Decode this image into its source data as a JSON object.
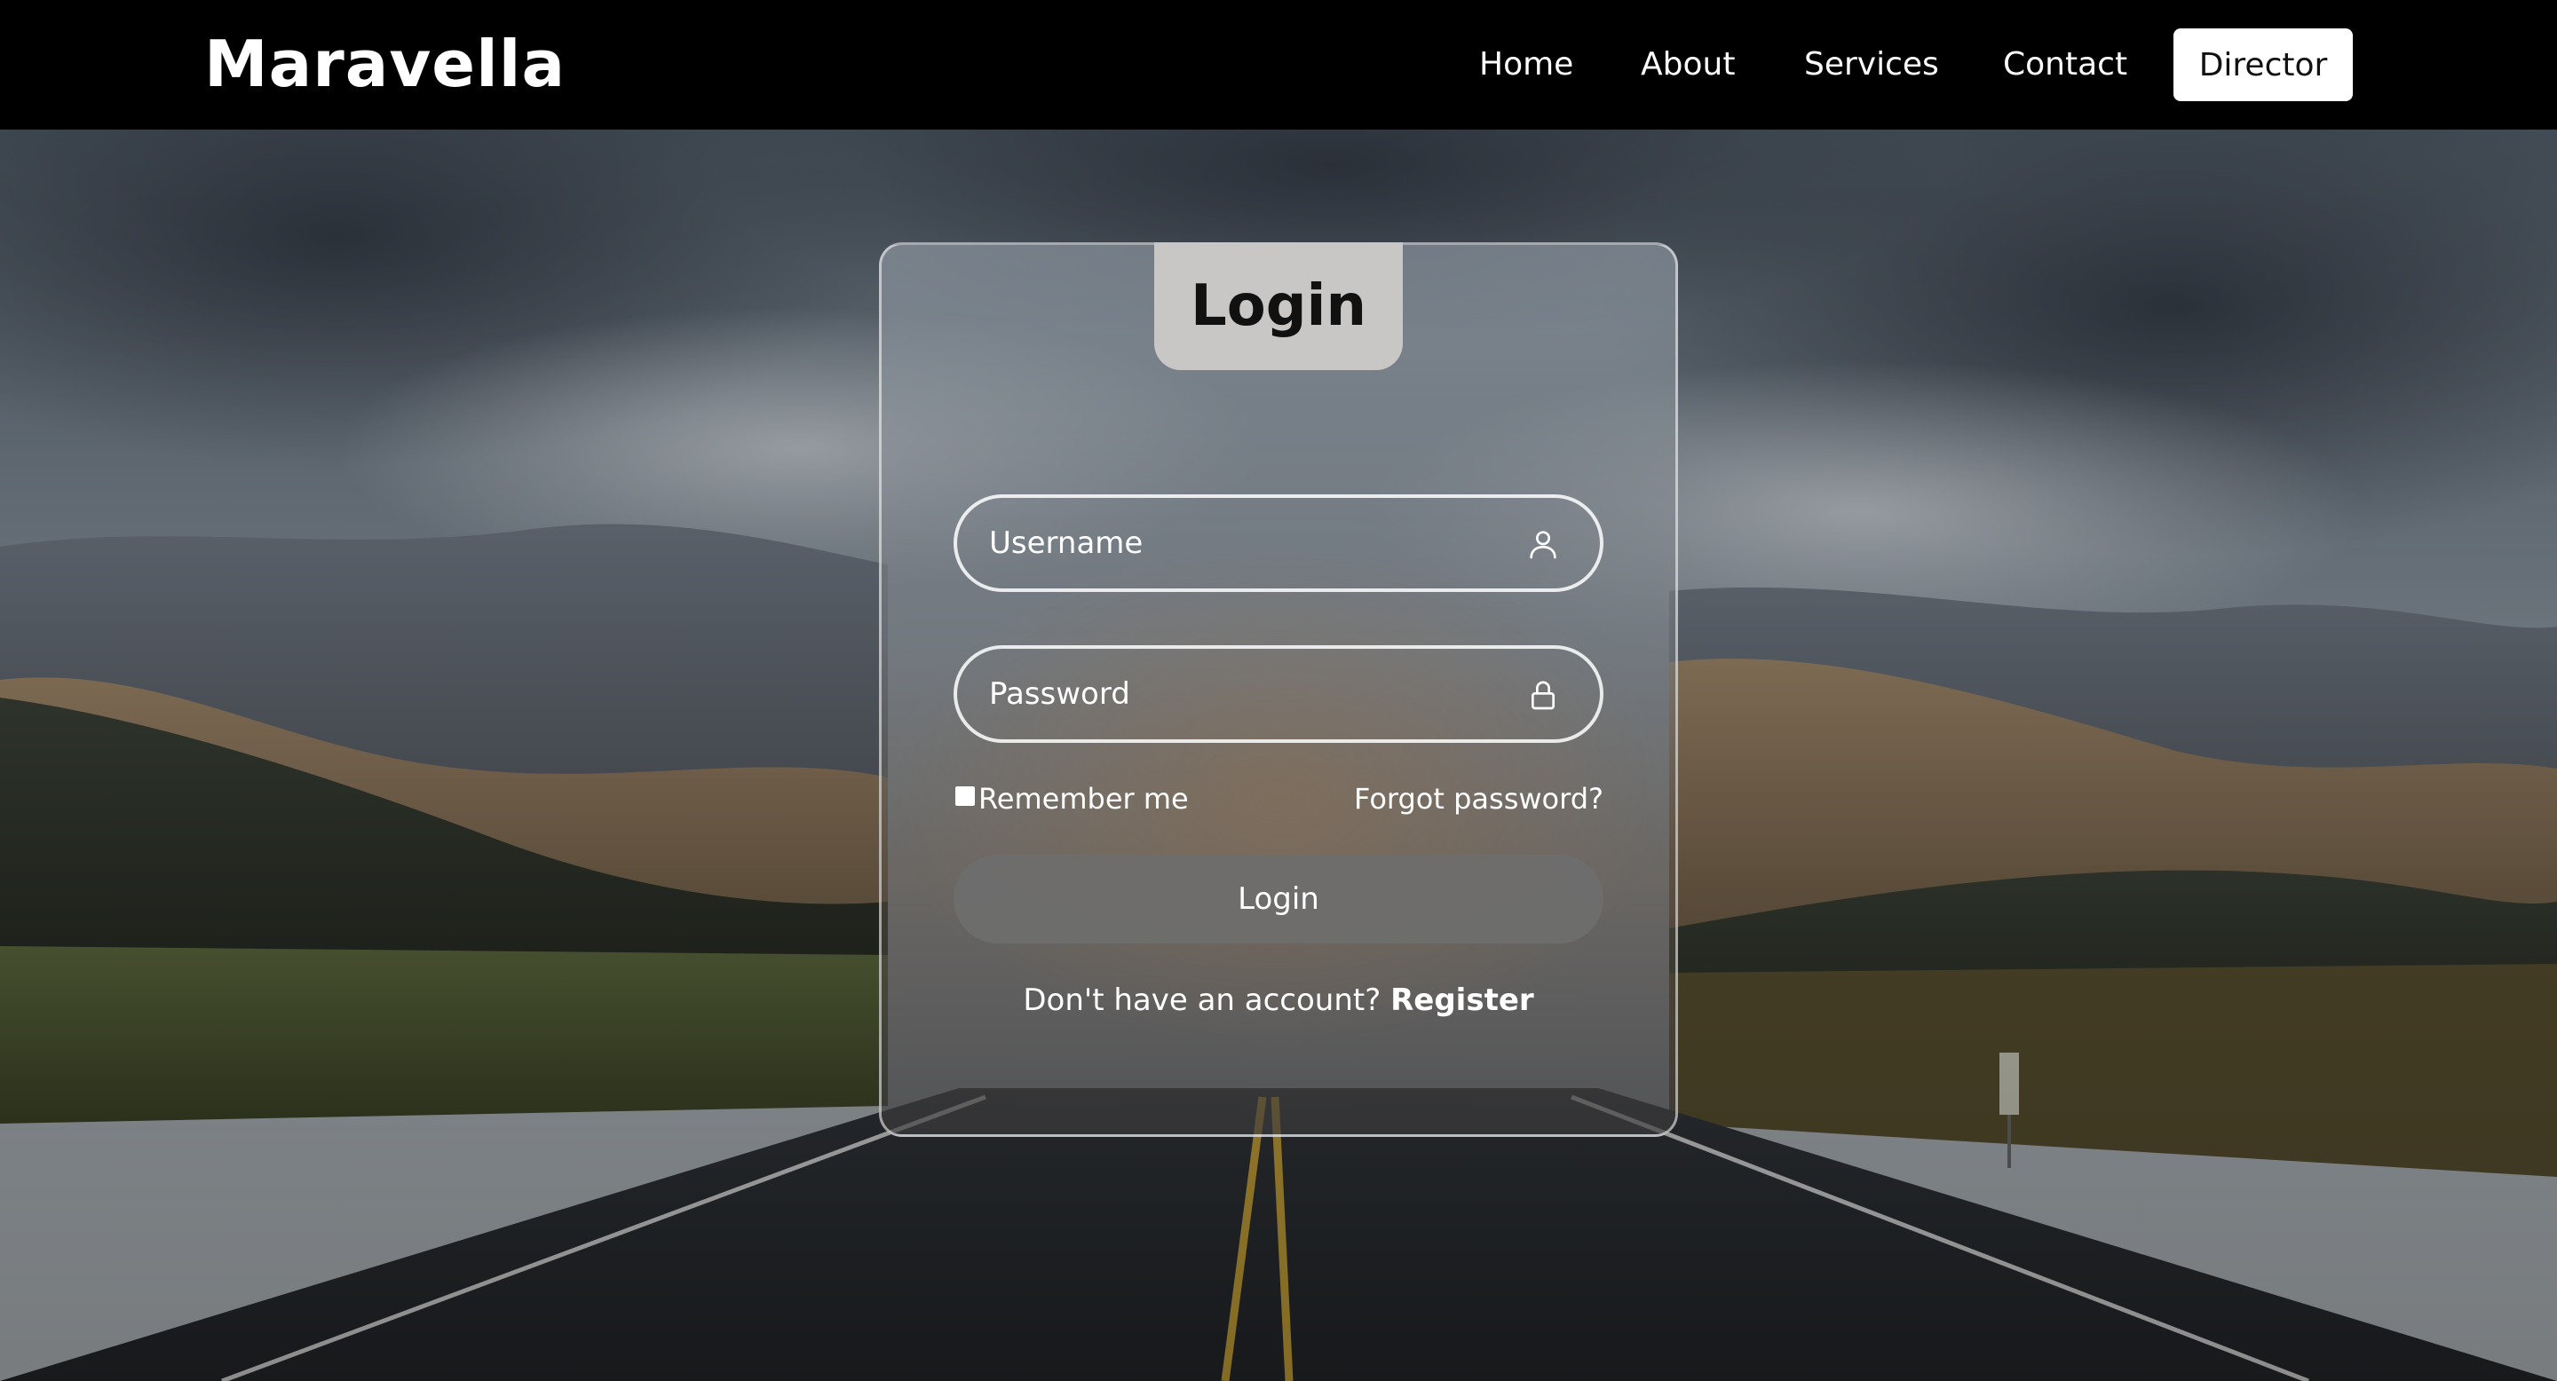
{
  "header": {
    "brand": "Maravella",
    "nav": {
      "home": "Home",
      "about": "About",
      "services": "Services",
      "contact": "Contact",
      "director": "Director"
    }
  },
  "login": {
    "title": "Login",
    "username_placeholder": "Username",
    "password_placeholder": "Password",
    "remember_label": "Remember me",
    "forgot_label": "Forgot password?",
    "submit_label": "Login",
    "register_prompt": "Don't have an account?",
    "register_link": "Register"
  },
  "icons": {
    "username": "user-icon",
    "password": "lock-icon"
  },
  "colors": {
    "header_bg": "#000000",
    "director_bg": "#ffffff",
    "tab_bg": "#c9c6c6",
    "button_bg": "#6e6e6e"
  }
}
